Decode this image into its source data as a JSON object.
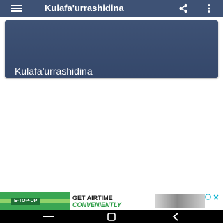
{
  "app_bar": {
    "title": "Kulafa'urrashidina",
    "menu_icon": "hamburger-menu-icon",
    "share_icon": "share-icon",
    "overflow_icon": "more-vert-icon",
    "background_color": "#3e5275"
  },
  "card": {
    "title": "Kulafa'urrashidina",
    "background_color": "#3e5275"
  },
  "ad_banner": {
    "badge_text": "E-TOP-UP",
    "headline": "GET AIRTIME",
    "subline": "CONVENIENTLY",
    "info_icon": "ad-info-icon",
    "close_icon": "ad-close-icon",
    "accent_color": "#3aa653"
  },
  "nav_bar": {
    "home_indicator_icon": "recents-icon",
    "home_icon": "home-icon",
    "back_icon": "back-icon"
  }
}
